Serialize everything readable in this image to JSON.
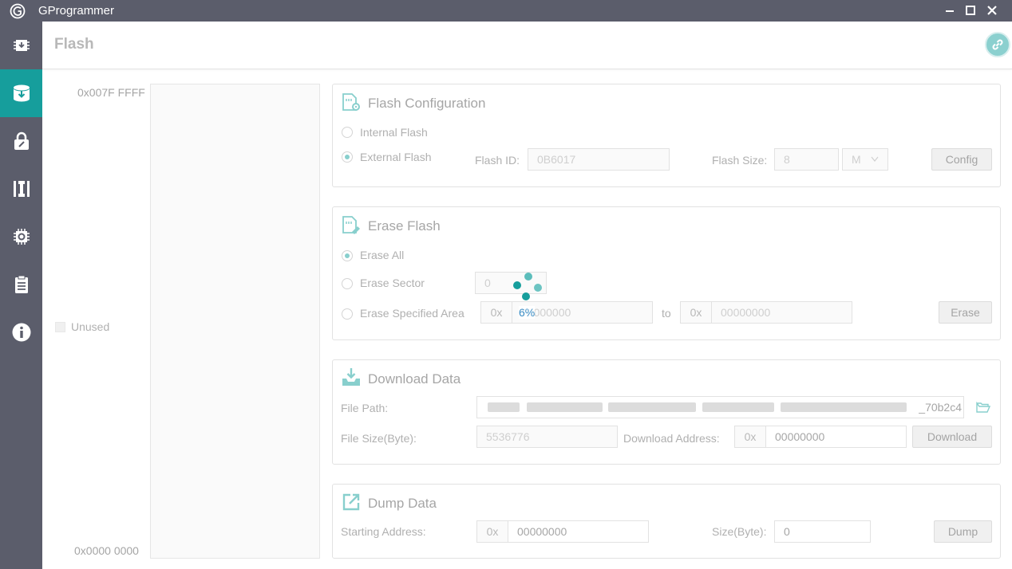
{
  "app": {
    "title": "GProgrammer"
  },
  "header": {
    "title": "Flash"
  },
  "memory_map": {
    "top_address": "0x007F FFFF",
    "bottom_address": "0x0000 0000",
    "legend_label": "Unused"
  },
  "flash_config": {
    "title": "Flash Configuration",
    "internal_label": "Internal Flash",
    "external_label": "External Flash",
    "selected": "External Flash",
    "flash_id_label": "Flash ID:",
    "flash_id_value": "0B6017",
    "flash_size_label": "Flash Size:",
    "flash_size_value": "8",
    "flash_size_unit": "M",
    "config_button": "Config"
  },
  "erase": {
    "title": "Erase Flash",
    "erase_all_label": "Erase All",
    "erase_sector_label": "Erase Sector",
    "erase_area_label": "Erase Specified Area",
    "selected": "Erase All",
    "sector_value": "0",
    "prefix": "0x",
    "start_value": "00000000",
    "to_label": "to",
    "end_value": "00000000",
    "erase_button": "Erase"
  },
  "progress": {
    "percent_text": "6%"
  },
  "download": {
    "title": "Download Data",
    "file_path_label": "File Path:",
    "file_path_visible_tail": "_70b2c4",
    "file_size_label": "File Size(Byte):",
    "file_size_value": "5536776",
    "address_label": "Download Address:",
    "prefix": "0x",
    "address_value": "00000000",
    "download_button": "Download"
  },
  "dump": {
    "title": "Dump Data",
    "start_label": "Starting Address:",
    "prefix": "0x",
    "start_value": "00000000",
    "size_label": "Size(Byte):",
    "size_value": "0",
    "dump_button": "Dump"
  },
  "colors": {
    "sidebar": "#5b5d6b",
    "accent": "#169e9c",
    "spinner": "#169e9c",
    "progress_text": "#3a8cc4"
  }
}
